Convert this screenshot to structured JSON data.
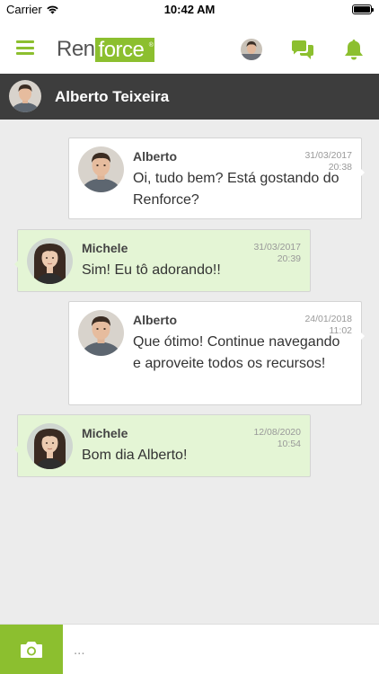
{
  "status_bar": {
    "carrier": "Carrier",
    "time": "10:42 AM"
  },
  "header": {
    "logo_part1": "Ren",
    "logo_part2": "force",
    "icons": [
      "menu-icon",
      "avatar",
      "chat-bubbles-icon",
      "bell-icon"
    ]
  },
  "conversation": {
    "contact_name": "Alberto Teixeira"
  },
  "messages": [
    {
      "side": "sent",
      "sender": "Alberto",
      "date": "31/03/2017",
      "time": "20:38",
      "text": "Oi, tudo bem? Está gostando do Renforce?"
    },
    {
      "side": "received",
      "sender": "Michele",
      "date": "31/03/2017",
      "time": "20:39",
      "text": "Sim! Eu tô adorando!!"
    },
    {
      "side": "sent",
      "sender": "Alberto",
      "date": "24/01/2018",
      "time": "11:02",
      "text": "Que ótimo! Continue navegando e aproveite todos os recursos!"
    },
    {
      "side": "received",
      "sender": "Michele",
      "date": "12/08/2020",
      "time": "10:54",
      "text": "Bom dia Alberto!"
    }
  ],
  "composer": {
    "placeholder": "..."
  },
  "colors": {
    "brand_green": "#8cbf2f",
    "header_dark": "#3d3d3d",
    "received_bubble": "#e4f5d5",
    "sent_bubble": "#ffffff",
    "background": "#ececec"
  }
}
